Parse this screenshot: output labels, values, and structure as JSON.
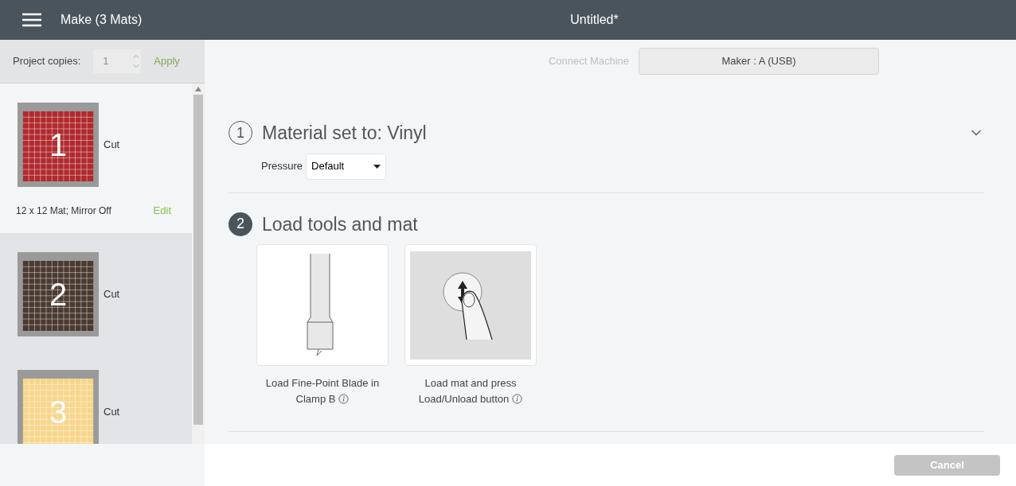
{
  "header": {
    "title": "Make (3 Mats)",
    "document": "Untitled*"
  },
  "copies": {
    "label": "Project copies:",
    "value": "1",
    "apply": "Apply",
    "disabled": true
  },
  "mats": [
    {
      "number": "1",
      "color": "#b02a2e",
      "action": "Cut",
      "selected": true,
      "info": "12 x 12 Mat; Mirror Off",
      "edit": "Edit"
    },
    {
      "number": "2",
      "color": "#4a3a30",
      "action": "Cut",
      "selected": false
    },
    {
      "number": "3",
      "color": "#f7d68c",
      "action": "Cut",
      "selected": false
    }
  ],
  "machine": {
    "label": "Connect Machine",
    "device": "Maker : A (USB)"
  },
  "steps": [
    {
      "number": "1",
      "title": "Material set to: Vinyl",
      "filled": false,
      "collapsible": true,
      "pressure": {
        "label": "Pressure",
        "value": "Default"
      }
    },
    {
      "number": "2",
      "title": "Load tools and mat",
      "filled": true,
      "cards": [
        {
          "kind": "blade",
          "caption": "Load Fine-Point Blade in Clamp B"
        },
        {
          "kind": "load",
          "caption": "Load mat and press Load/Unload button"
        }
      ]
    }
  ],
  "footer": {
    "cancel": "Cancel"
  }
}
